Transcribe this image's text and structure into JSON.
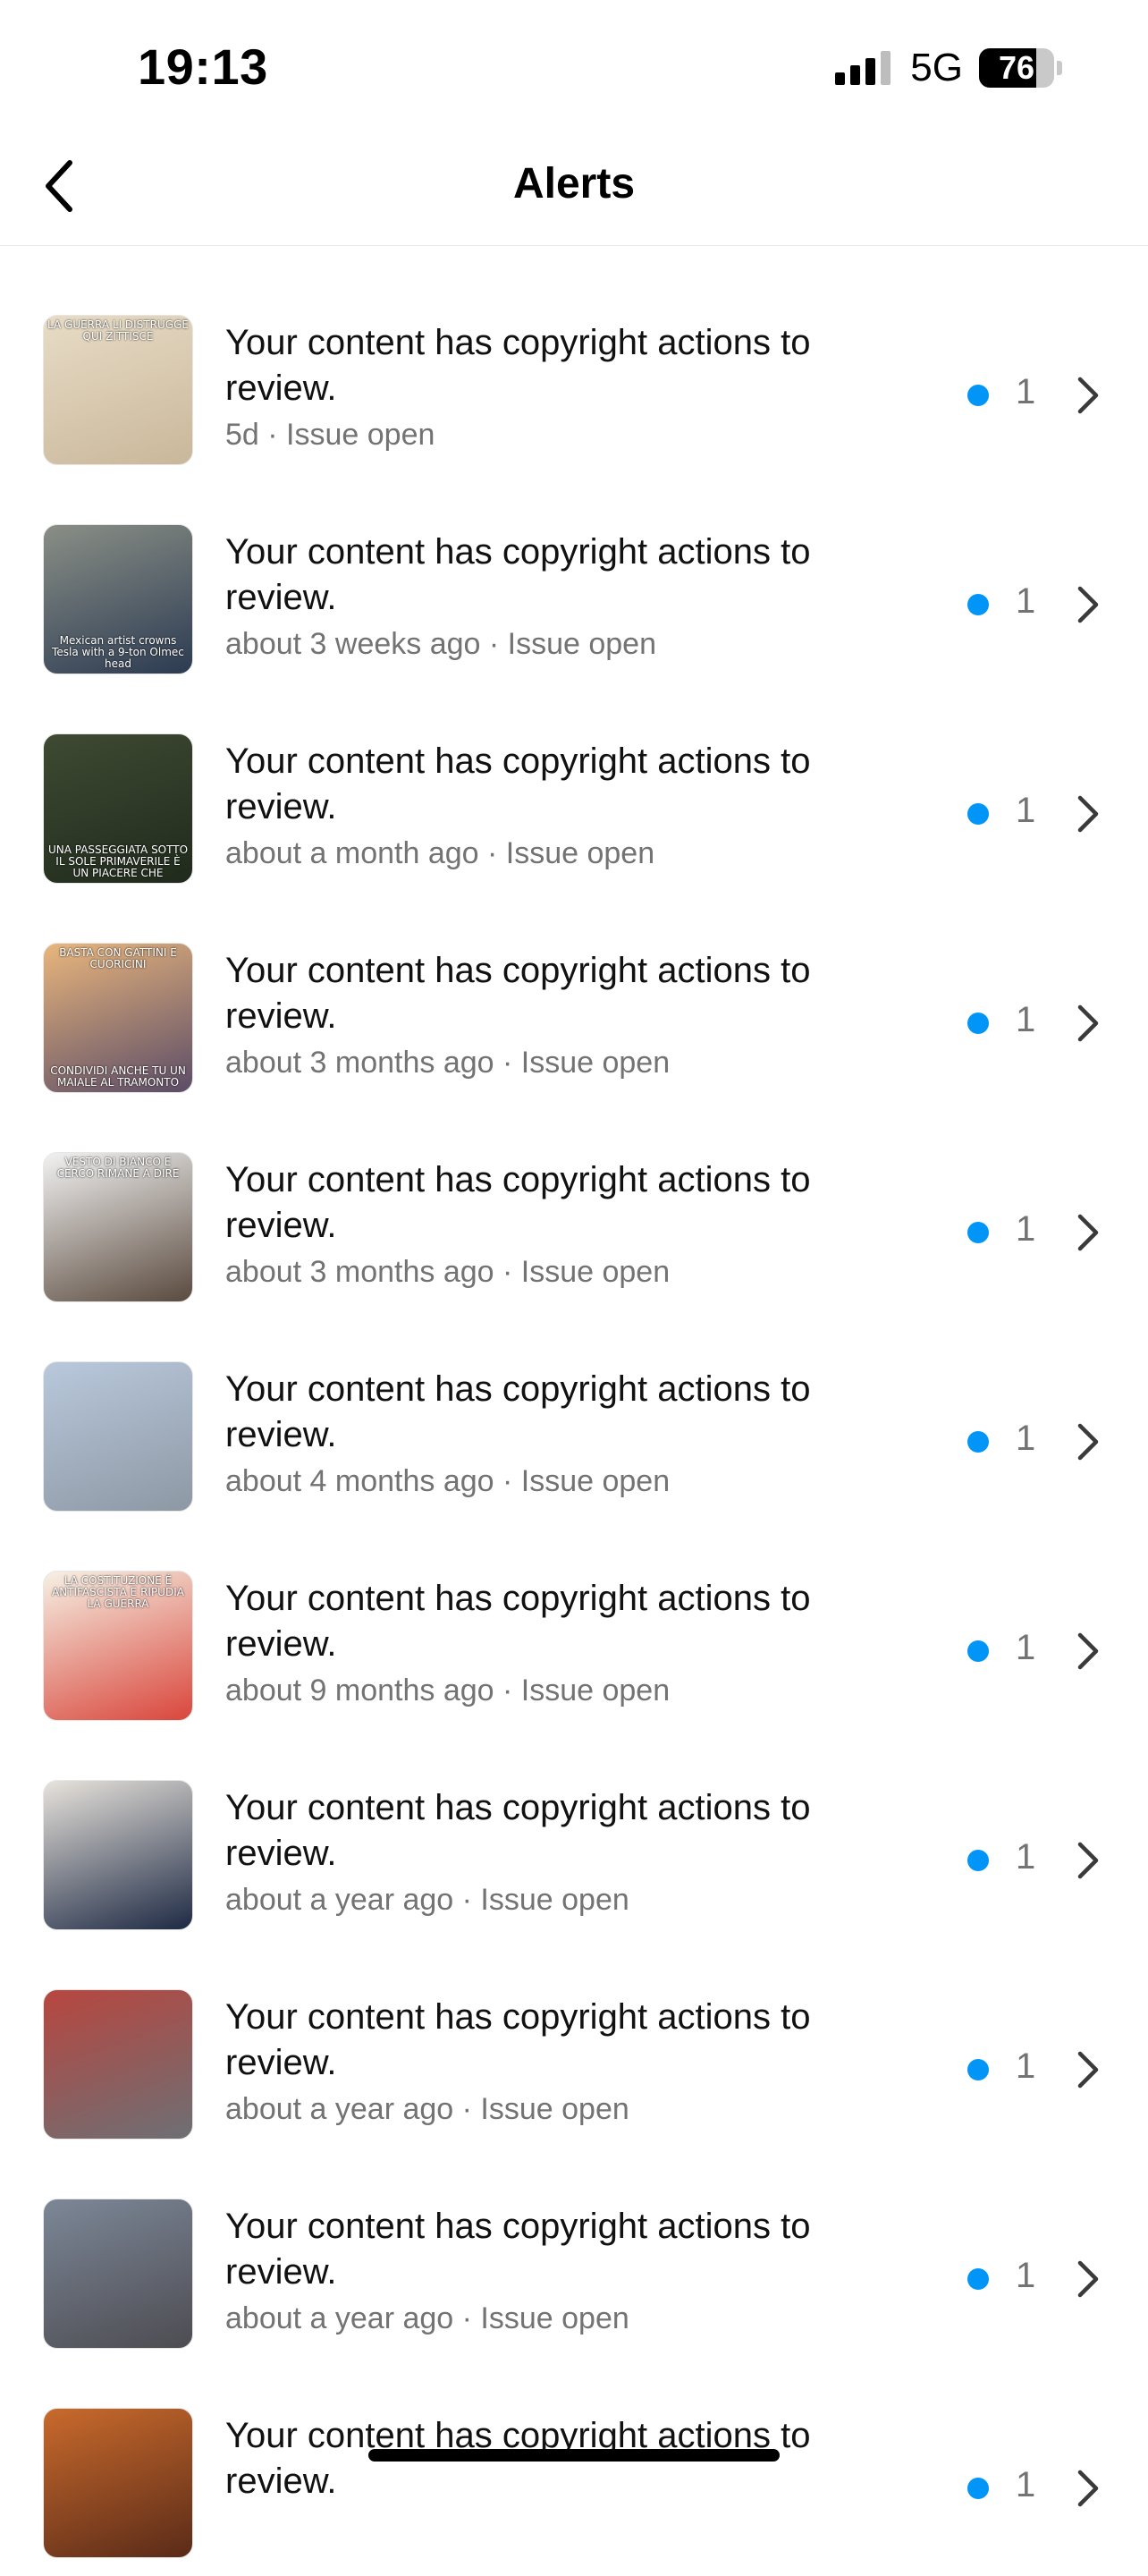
{
  "status_bar": {
    "time": "19:13",
    "network": "5G",
    "battery_level": "76",
    "battery_fraction": 0.76,
    "signal_bars_active": 3
  },
  "header": {
    "title": "Alerts",
    "back_icon": "chevron-left-icon"
  },
  "colors": {
    "badge": "#0095f6",
    "meta_text": "#737373",
    "title_text": "#111111"
  },
  "alerts": [
    {
      "title": "Your content has copyright actions to review.",
      "meta": "5d · Issue open",
      "count": "1",
      "thumb": {
        "palette": [
          "#e8dcc6",
          "#c9b79a"
        ],
        "caption_top": "LA GUERRA LI DISTRUGGE QUI ZITTISCE",
        "caption_bottom": ""
      }
    },
    {
      "title": "Your content has copyright actions to review.",
      "meta": "about 3 weeks ago · Issue open",
      "count": "1",
      "thumb": {
        "palette": [
          "#8a8f86",
          "#2c3b52"
        ],
        "caption_top": "",
        "caption_bottom": "Mexican artist crowns Tesla with a 9-ton Olmec head"
      }
    },
    {
      "title": "Your content has copyright actions to review.",
      "meta": "about a month ago · Issue open",
      "count": "1",
      "thumb": {
        "palette": [
          "#3f4a33",
          "#1f2a1c"
        ],
        "caption_top": "",
        "caption_bottom": "UNA PASSEGGIATA SOTTO IL SOLE PRIMAVERILE È UN PIACERE CHE"
      }
    },
    {
      "title": "Your content has copyright actions to review.",
      "meta": "about 3 months ago · Issue open",
      "count": "1",
      "thumb": {
        "palette": [
          "#e9b67d",
          "#5b4c66"
        ],
        "caption_top": "BASTA CON GATTINI E CUORICINI",
        "caption_bottom": "CONDIVIDI ANCHE TU UN MAIALE AL TRAMONTO"
      }
    },
    {
      "title": "Your content has copyright actions to review.",
      "meta": "about 3 months ago · Issue open",
      "count": "1",
      "thumb": {
        "palette": [
          "#f2f2f2",
          "#5a4a3e"
        ],
        "caption_top": "VESTO DI BIANCO E CERCO RIMANE A DIRE",
        "caption_bottom": ""
      }
    },
    {
      "title": "Your content has copyright actions to review.",
      "meta": "about 4 months ago · Issue open",
      "count": "1",
      "thumb": {
        "palette": [
          "#b9c8dc",
          "#8d98a4"
        ],
        "caption_top": "",
        "caption_bottom": ""
      }
    },
    {
      "title": "Your content has copyright actions to review.",
      "meta": "about 9 months ago · Issue open",
      "count": "1",
      "thumb": {
        "palette": [
          "#f6f1e4",
          "#d9463c"
        ],
        "caption_top": "LA COSTITUZIONE È ANTIFASCISTA E RIPUDIA LA GUERRA",
        "caption_bottom": ""
      }
    },
    {
      "title": "Your content has copyright actions to review.",
      "meta": "about a year ago · Issue open",
      "count": "1",
      "thumb": {
        "palette": [
          "#e8e3dc",
          "#1e2a44"
        ],
        "caption_top": "",
        "caption_bottom": ""
      }
    },
    {
      "title": "Your content has copyright actions to review.",
      "meta": "about a year ago · Issue open",
      "count": "1",
      "thumb": {
        "palette": [
          "#b8463f",
          "#6d6f74"
        ],
        "caption_top": "",
        "caption_bottom": ""
      }
    },
    {
      "title": "Your content has copyright actions to review.",
      "meta": "about a year ago · Issue open",
      "count": "1",
      "thumb": {
        "palette": [
          "#7c8797",
          "#4d4c52"
        ],
        "caption_top": "",
        "caption_bottom": ""
      }
    },
    {
      "title": "Your content has copyright actions to review.",
      "meta": "",
      "count": "1",
      "thumb": {
        "palette": [
          "#c96a2c",
          "#5a2b18"
        ],
        "caption_top": "",
        "caption_bottom": ""
      }
    }
  ]
}
